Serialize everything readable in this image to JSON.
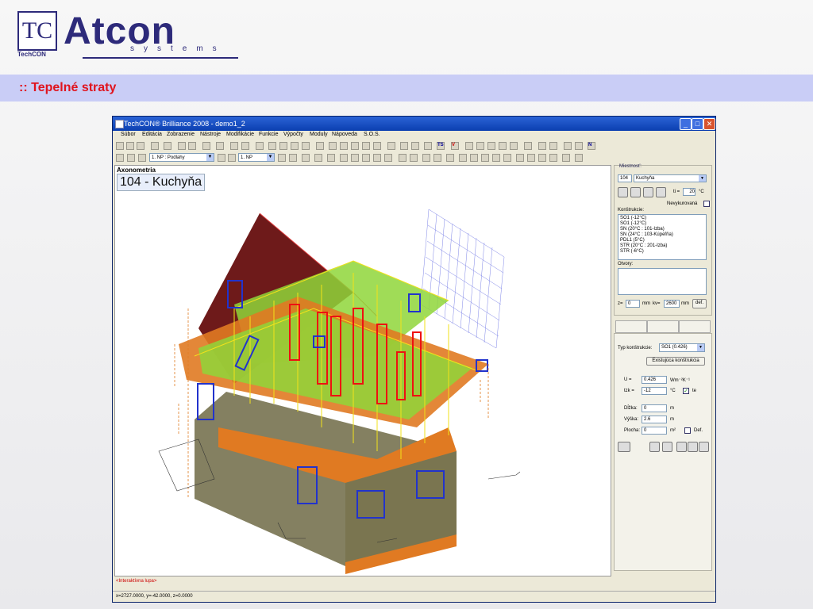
{
  "slide": {
    "logo_mark": "TC",
    "logo_sub": "TechCON",
    "logo_word": "Atcon",
    "logo_systems": "systems",
    "title": ":: Tepelné straty"
  },
  "window": {
    "title": "TechCON® Brilliance 2008   - demo1_2",
    "controls": [
      "_",
      "□",
      "✕"
    ]
  },
  "menu": [
    "Súbor",
    "Editácia",
    "Zobrazenie",
    "Nástroje",
    "Modifikácie",
    "Funkcie",
    "Výpočty",
    "Moduly",
    "Nápoveda",
    "S.O.S."
  ],
  "toolbar": {
    "layer_combo": "1. NP : Podlahy",
    "floor_combo": "1. NP",
    "ts_label": "TS",
    "v_label": "V",
    "n_label": "N"
  },
  "view": {
    "title": "Axonometria",
    "room_label": "104 - Kuchyňa"
  },
  "status": {
    "hint": "<Interaktívna lupa>",
    "coords": "x=2727.0000, y=-42.0000, z=0.0000"
  },
  "panel": {
    "room_group_label": "Miestnosť:",
    "room_number": "104",
    "room_name": "Kuchyňa",
    "ti_label": "ti =",
    "ti_value": "20",
    "ti_unit": "°C",
    "unheated_label": "Nevykurovaná",
    "constructions_label": "Konštrukcie:",
    "constructions": [
      "SO1   (-12°C)",
      "SO1   (-12°C)",
      "SN   (20°C : 101-Izba)",
      "SN   (24°C : 103-Kúpeľňa)",
      "PDL1   (5°C)",
      "STR   (20°C : 201-Izba)",
      "STR   (-6°C)"
    ],
    "openings_label": "Otvory:",
    "z_label": "z=",
    "z_value": "0",
    "z_unit": "mm",
    "kv_label": "kv=",
    "kv_value": "2600",
    "kv_unit": "mm",
    "def_button": "def.",
    "type_label": "Typ konštrukcie:",
    "type_value": "SO1  (0.426)",
    "existing_button": "Existujúca konštrukcia",
    "u_label": "U  =",
    "u_value": "0.426",
    "u_unit": "Wm⁻²K⁻¹",
    "tzk_label": "tzk =",
    "tzk_value": "-12",
    "tzk_unit": "°C",
    "te_label": "te",
    "length_label": "Dĺžka:",
    "length_value": "0",
    "length_unit": "m",
    "height_label": "Výška:",
    "height_value": "2.6",
    "height_unit": "m",
    "area_label": "Plocha:",
    "area_value": "0",
    "area_unit": "m²",
    "def_label": "Def."
  },
  "colors": {
    "accent_title": "#e0141e",
    "title_band": "#c9cdf6",
    "roof": "#6e1a1a",
    "slab": "#e07a22",
    "floor": "#8fd63a",
    "wall_red": "#ee1111",
    "window_blue": "#2233cc",
    "frame_yellow": "#f2e21a"
  }
}
